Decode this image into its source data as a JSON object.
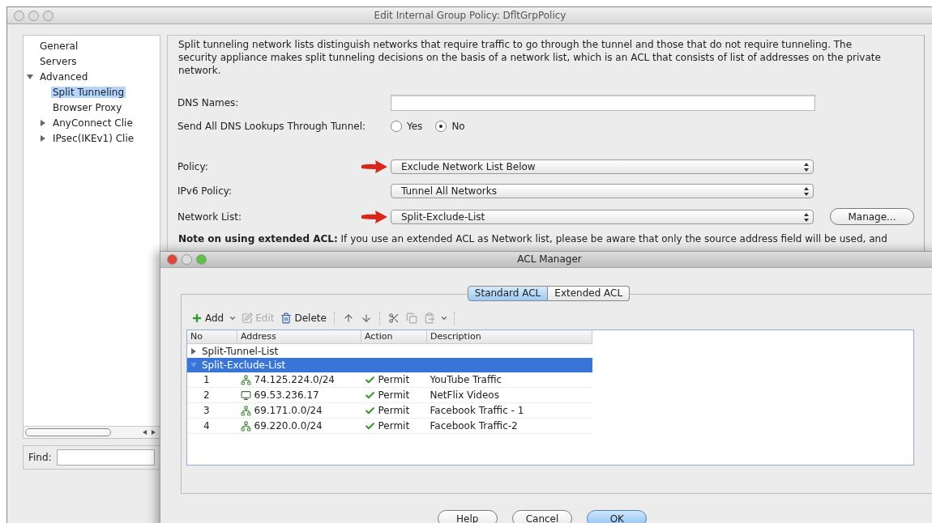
{
  "window": {
    "title": "Edit Internal Group Policy: DfltGrpPolicy"
  },
  "sidebar": {
    "items": [
      {
        "label": "General",
        "selected": false
      },
      {
        "label": "Servers",
        "selected": false
      },
      {
        "label": "Advanced",
        "selected": false,
        "expanded": true,
        "children": [
          {
            "label": "Split Tunneling",
            "selected": true
          },
          {
            "label": "Browser Proxy",
            "selected": false
          },
          {
            "label": "AnyConnect Clie",
            "selected": false,
            "expanded": false
          },
          {
            "label": "IPsec(IKEv1) Clie",
            "selected": false,
            "expanded": false
          }
        ]
      }
    ]
  },
  "find": {
    "label": "Find:"
  },
  "intro": "Split tunneling network lists distinguish networks that require traffic to go through the tunnel and those that do not require tunneling. The security appliance makes split tunneling decisions on the basis of a network list, which is an ACL that consists of list of addresses on the private network.",
  "dns_names": {
    "label": "DNS Names:"
  },
  "send_dns": {
    "label": "Send All DNS Lookups Through Tunnel:",
    "options": [
      {
        "label": "Yes",
        "selected": false
      },
      {
        "label": "No",
        "selected": true
      }
    ]
  },
  "selects": [
    {
      "label": "Policy:",
      "value": "Exclude Network List Below",
      "annotated": true
    },
    {
      "label": "IPv6 Policy:",
      "value": "Tunnel All Networks",
      "annotated": false
    },
    {
      "label": "Network List:",
      "value": "Split-Exclude-List",
      "annotated": true,
      "button": "Manage..."
    }
  ],
  "note": "**Note on using extended ACL:** If you use an extended ACL as Network list, please be aware that only the source address field will be used, and",
  "acl_manager": {
    "title": "ACL Manager",
    "tabs": [
      {
        "label": "Standard ACL",
        "selected": true
      },
      {
        "label": "Extended ACL",
        "selected": false
      }
    ],
    "toolbar": [
      {
        "kind": "add",
        "label": "Add",
        "disabled": false,
        "menu": true
      },
      {
        "kind": "edit",
        "label": "Edit",
        "disabled": true,
        "menu": false
      },
      {
        "kind": "delete",
        "label": "Delete",
        "disabled": false,
        "menu": false
      },
      {
        "kind": "up",
        "disabled": false,
        "menu": false
      },
      {
        "kind": "down",
        "disabled": false,
        "menu": false
      },
      {
        "kind": "cut",
        "disabled": false,
        "menu": false
      },
      {
        "kind": "copy",
        "disabled": true,
        "menu": false
      },
      {
        "kind": "paste",
        "disabled": true,
        "menu": true
      }
    ],
    "columns": [
      "No",
      "Address",
      "Action",
      "Description"
    ],
    "groups": [
      {
        "name": "Split-Tunnel-List",
        "expanded": false,
        "selected": false
      },
      {
        "name": "Split-Exclude-List",
        "expanded": true,
        "selected": true,
        "rows": [
          {
            "no": "1",
            "kind": "network",
            "address": "74.125.224.0/24",
            "action": "Permit",
            "description": "YouTube Traffic"
          },
          {
            "no": "2",
            "kind": "host",
            "address": "69.53.236.17",
            "action": "Permit",
            "description": "NetFlix Videos"
          },
          {
            "no": "3",
            "kind": "network",
            "address": "69.171.0.0/24",
            "action": "Permit",
            "description": "Facebook Traffic - 1"
          },
          {
            "no": "4",
            "kind": "network",
            "address": "69.220.0.0/24",
            "action": "Permit",
            "description": "Facebook Traffic-2"
          }
        ]
      }
    ],
    "buttons": [
      {
        "label": "Help",
        "default": false
      },
      {
        "label": "Cancel",
        "default": false
      },
      {
        "label": "OK",
        "default": true
      }
    ]
  }
}
